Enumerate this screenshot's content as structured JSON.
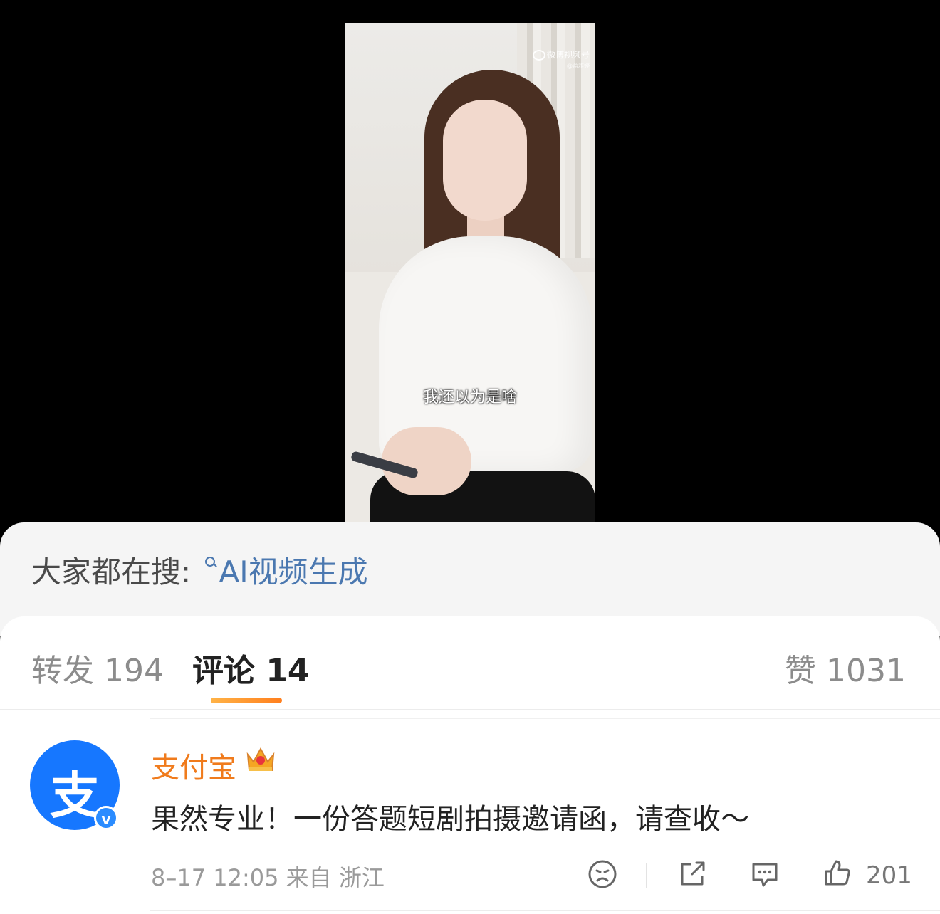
{
  "video": {
    "watermark": "微博视频号",
    "watermark_sub": "@蓝雅婷",
    "subtitle": "我还以为是啥"
  },
  "search": {
    "label": "大家都在搜:",
    "query": "AI视频生成"
  },
  "tabs": {
    "repost": "转发 194",
    "comment": "评论 14",
    "like": "赞 1031"
  },
  "comment": {
    "avatar_glyph": "支",
    "username": "支付宝",
    "text": "果然专业！一份答题短剧拍摄邀请函，请查收～",
    "meta": "8–17 12:05  来自 浙江",
    "like_count": "201"
  },
  "colors": {
    "accent_orange": "#f07b1c",
    "link_blue": "#4b78b0",
    "avatar_blue": "#1677ff"
  },
  "icons": [
    "weibo-icon",
    "search-icon",
    "crown-icon",
    "verified-icon",
    "emoji-icon",
    "share-icon",
    "comment-icon",
    "like-icon"
  ]
}
